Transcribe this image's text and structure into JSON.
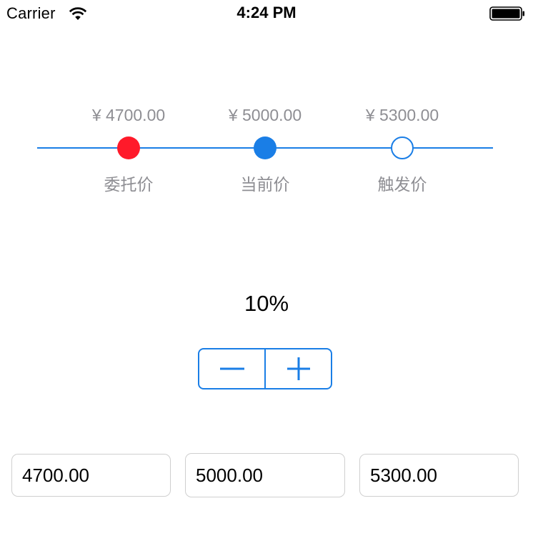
{
  "status_bar": {
    "carrier": "Carrier",
    "time": "4:24 PM"
  },
  "price_track": {
    "points": [
      {
        "price": "¥ 4700.00",
        "name": "委托价",
        "dot_color": "#ff1a2a",
        "filled": true
      },
      {
        "price": "¥ 5000.00",
        "name": "当前价",
        "dot_color": "#1a7ee6",
        "filled": true
      },
      {
        "price": "¥ 5300.00",
        "name": "触发价",
        "dot_color": "#1a7ee6",
        "filled": false
      }
    ],
    "track_color": "#1a7ee6"
  },
  "percent": {
    "value": "10%"
  },
  "stepper": {
    "minus_icon": "minus-icon",
    "plus_icon": "plus-icon",
    "accent": "#1a7ee6"
  },
  "fields": [
    {
      "value": "4700.00"
    },
    {
      "value": "5000.00"
    },
    {
      "value": "5300.00"
    }
  ]
}
